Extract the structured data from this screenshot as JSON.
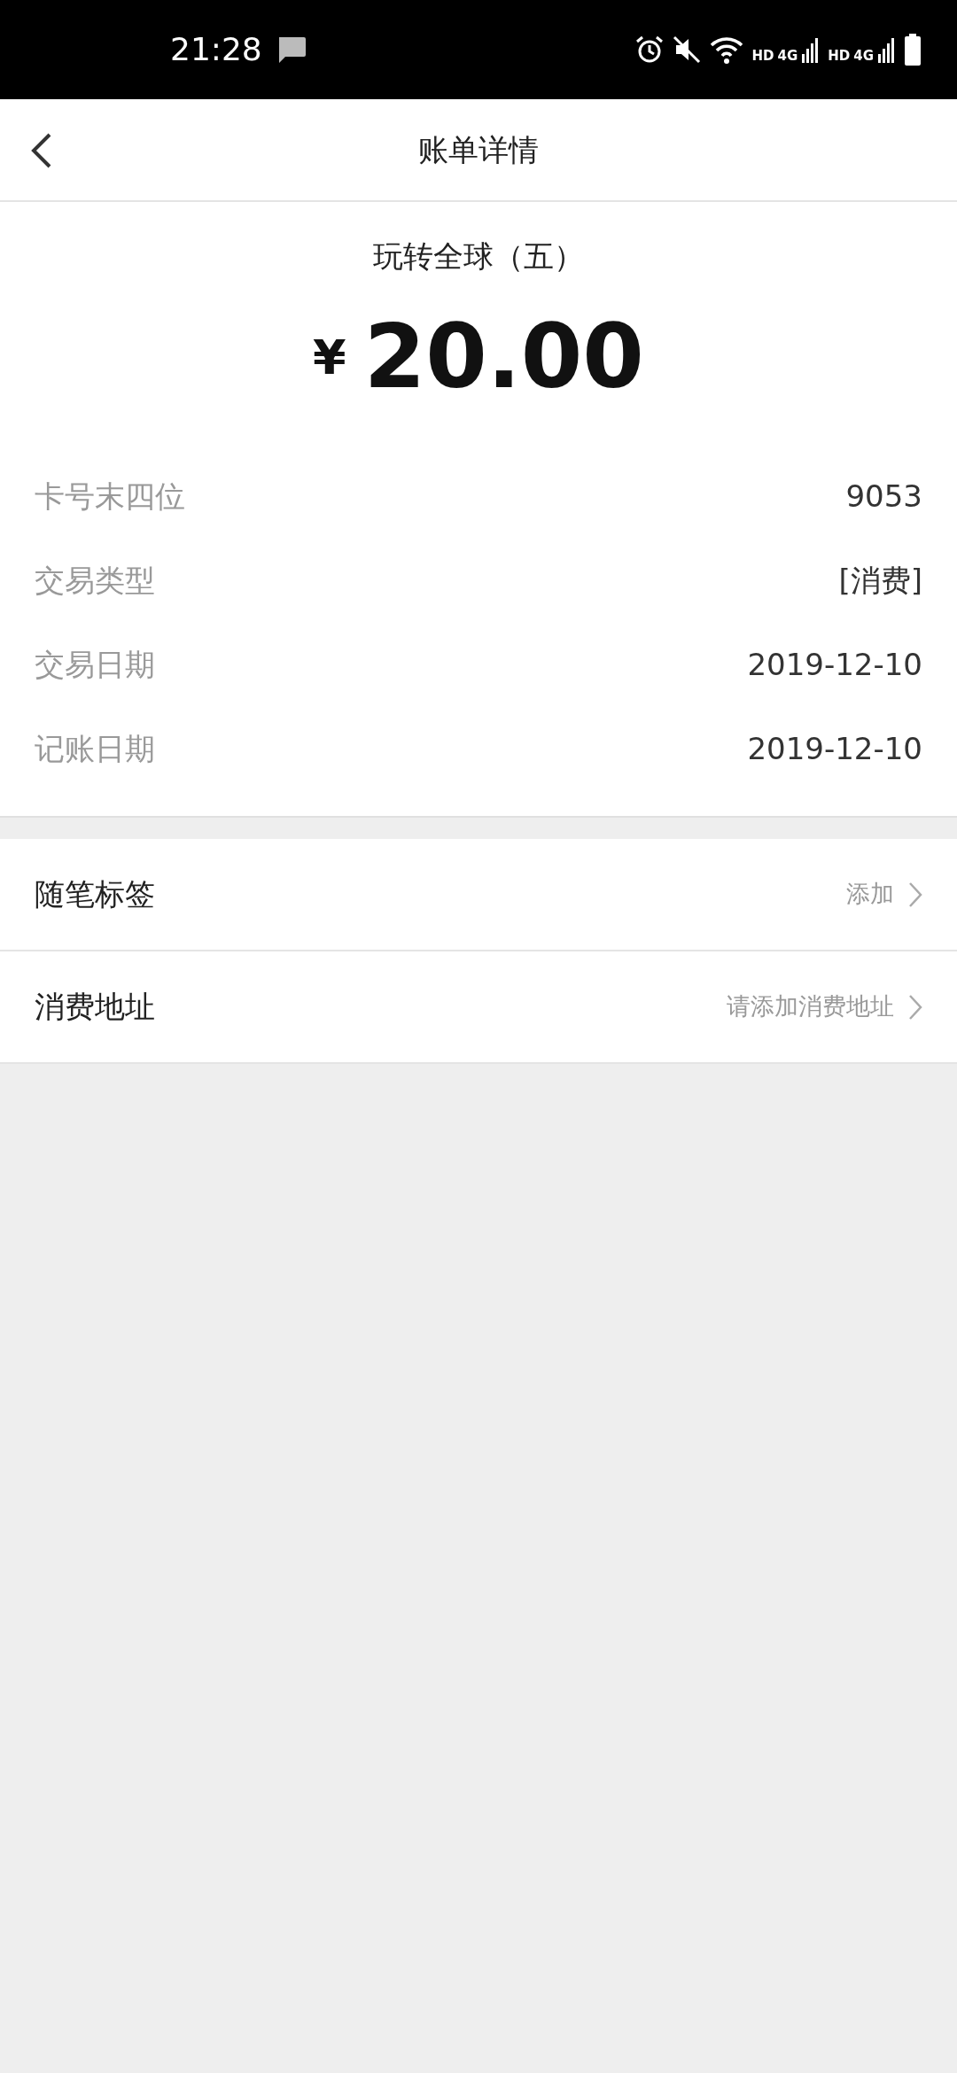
{
  "status_bar": {
    "time": "21:28",
    "network_labels": [
      {
        "hd": "HD",
        "gen": "4G"
      },
      {
        "hd": "HD",
        "gen": "4G"
      }
    ]
  },
  "nav": {
    "title": "账单详情"
  },
  "summary": {
    "merchant": "玩转全球（五）",
    "currency": "¥",
    "amount": "20.00"
  },
  "details": [
    {
      "label": "卡号末四位",
      "value": "9053"
    },
    {
      "label": "交易类型",
      "value": "[消费]"
    },
    {
      "label": "交易日期",
      "value": "2019-12-10"
    },
    {
      "label": "记账日期",
      "value": "2019-12-10"
    }
  ],
  "actions": [
    {
      "label": "随笔标签",
      "hint": "添加"
    },
    {
      "label": "消费地址",
      "hint": "请添加消费地址"
    }
  ]
}
